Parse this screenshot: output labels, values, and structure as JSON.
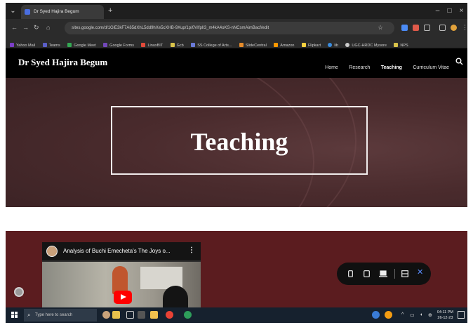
{
  "browser": {
    "tab_title": "Dr Syed Hajira Begum",
    "tab_close": "×",
    "new_tab": "+",
    "window_controls": [
      "–",
      "□",
      "×"
    ],
    "url": "sites.google.com/d/1GlE3kF7A65dXhL5dd9hXe5cXHB-9Xup/1p/0VIfpl/3_m4kA4oKS-nNCsmAimBacf/edit",
    "bookmarks": [
      "Yahoo Mail",
      "Teams",
      "Google Meet",
      "Google Forms",
      "LinuxBIT",
      "Gcb",
      "SS College of Arts...",
      "SlideCentral",
      "Amazon",
      "Flipkart",
      "lib",
      "UGC-HRDC Mysore",
      "NPS"
    ]
  },
  "site": {
    "title": "Dr Syed Hajira Begum",
    "nav": [
      "Home",
      "Research",
      "Teaching",
      "Curriculum Vitae"
    ],
    "active_nav": "Teaching",
    "search_icon": "search-icon"
  },
  "hero": {
    "heading": "Teaching"
  },
  "video": {
    "title": "Analysis of Buchi Emecheta's The Joys o...",
    "more": "⋮"
  },
  "preview_bar": {
    "items": [
      "phone-icon",
      "tablet-icon",
      "laptop-icon",
      "open-in-new-icon",
      "close-icon"
    ]
  },
  "taskbar": {
    "search_placeholder": "Type here to search",
    "time": "04:11 PM",
    "date": "26-12-23"
  },
  "colors": {
    "header_bg": "#000000",
    "hero_bg": "#4a2b2d",
    "section_bg": "#5b1c1f",
    "play_red": "#ff0000"
  }
}
